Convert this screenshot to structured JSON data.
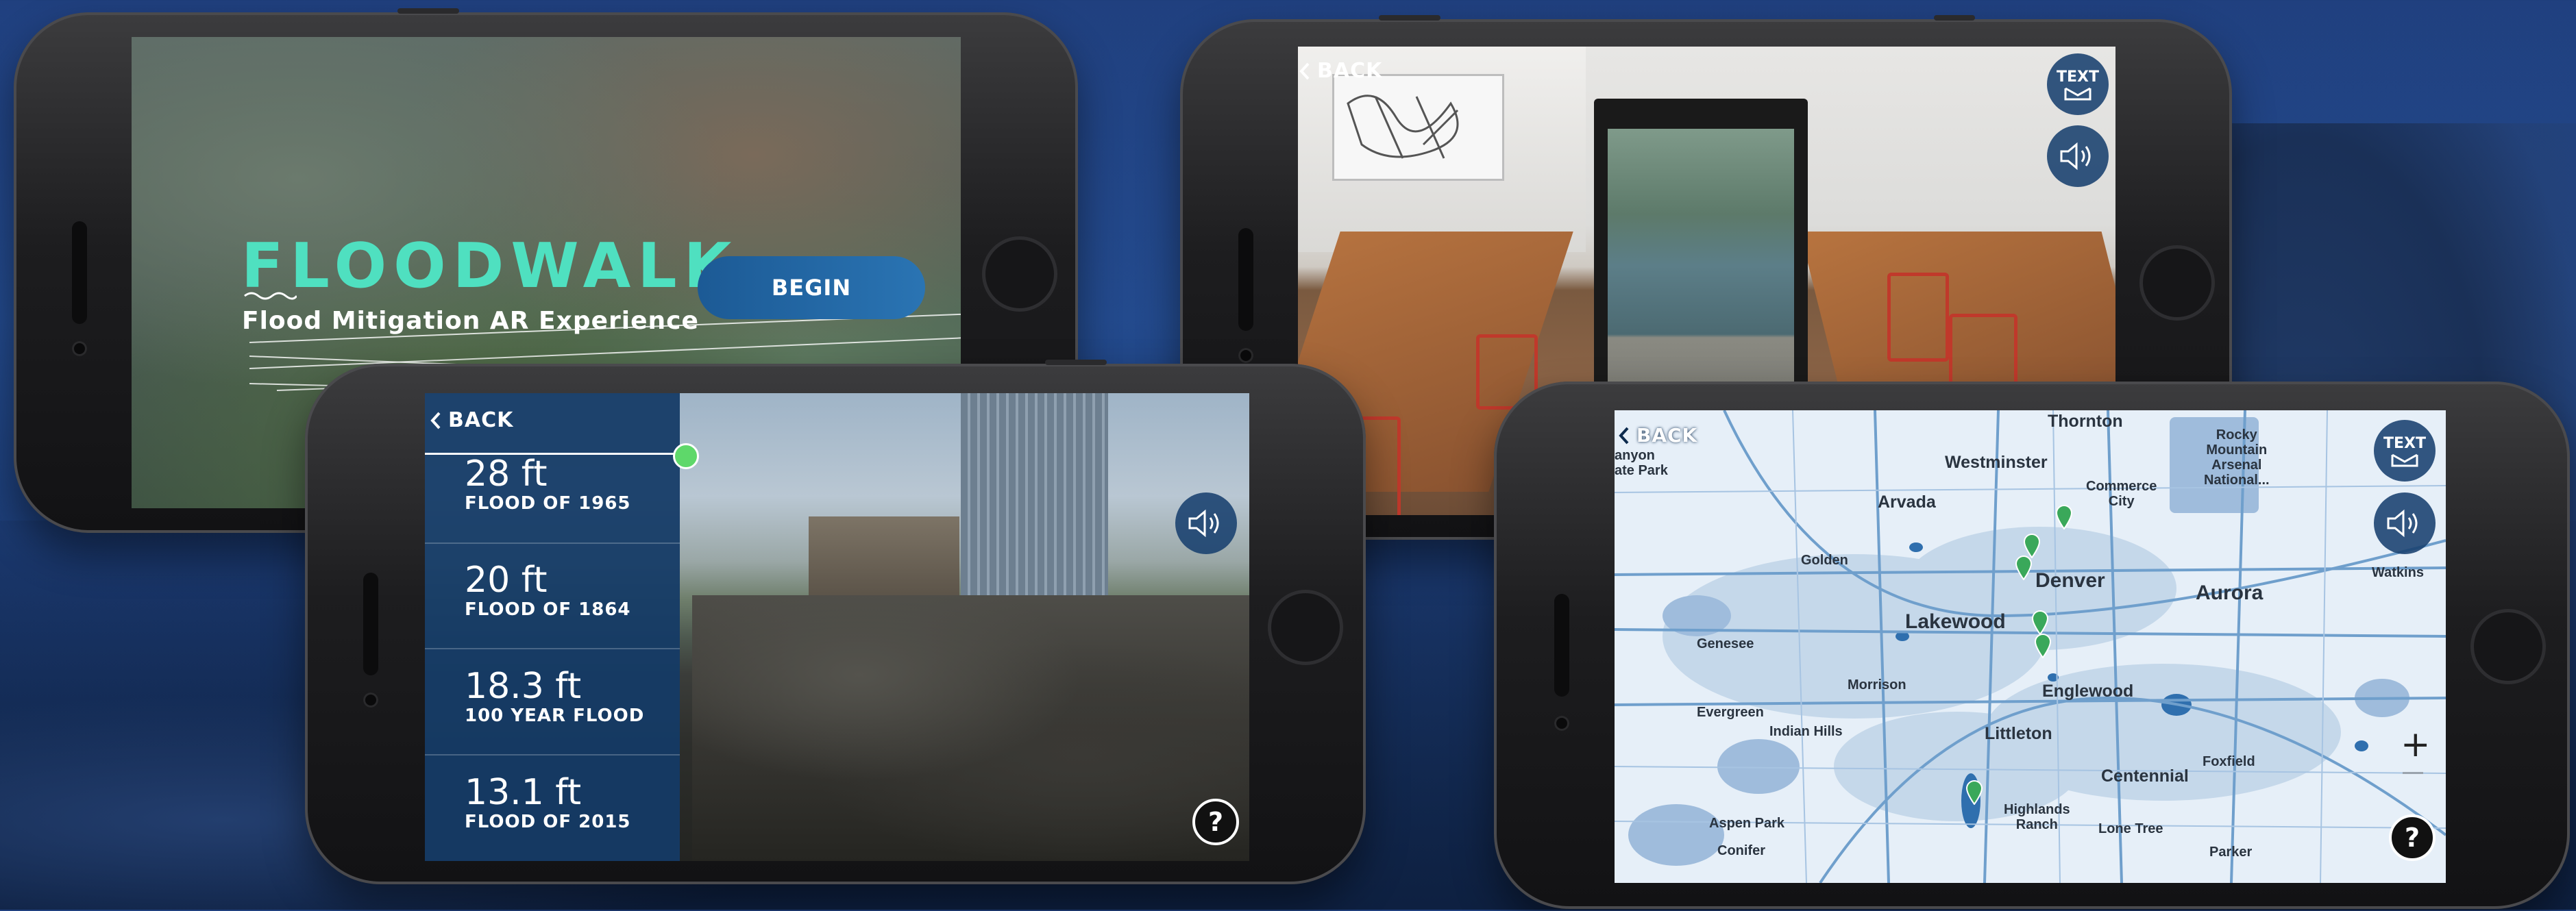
{
  "colors": {
    "title_teal": "#4fe0c0",
    "panel_blue": "#143a66",
    "accent_green": "#5ed86a",
    "button_blue": "#1c5a95"
  },
  "intro": {
    "title": "FLOODWALK",
    "subtitle": "Flood Mitigation AR Experience",
    "begin_label": "BEGIN"
  },
  "flood_screen": {
    "back_label": "BACK",
    "levels": [
      {
        "height": "28 ft",
        "name": "FLOOD OF 1965"
      },
      {
        "height": "20 ft",
        "name": "FLOOD OF 1864"
      },
      {
        "height": "18.3 ft",
        "name": "100 YEAR FLOOD"
      },
      {
        "height": "13.1 ft",
        "name": "FLOOD OF 2015"
      }
    ],
    "slider_level": 1.0,
    "help_label": "?",
    "icons": [
      "chevron-left-icon",
      "speaker-icon",
      "help-icon"
    ]
  },
  "portal_screen": {
    "back_label": "BACK",
    "text_button_label": "TEXT",
    "icons": [
      "chevron-left-icon",
      "text-message-icon",
      "speaker-icon"
    ]
  },
  "map_screen": {
    "back_label": "BACK",
    "text_button_label": "TEXT",
    "help_label": "?",
    "zoom_in_label": "+",
    "cities": {
      "thornton": "Thornton",
      "westminster": "Westminster",
      "rocky_mountain": "Rocky\nMountain\nArsenal\nNational...",
      "commerce_city": "Commerce\nCity",
      "arvada": "Arvada",
      "golden": "Golden",
      "denver": "Denver",
      "aurora": "Aurora",
      "watkins": "Watkins",
      "lakewood": "Lakewood",
      "genesee": "Genesee",
      "morrison": "Morrison",
      "englewood": "Englewood",
      "evergreen": "Evergreen",
      "indian_hills": "Indian Hills",
      "littleton": "Littleton",
      "centennial": "Centennial",
      "foxfield": "Foxfield",
      "highlands_ranch": "Highlands\nRanch",
      "lone_tree": "Lone Tree",
      "aspen_park": "Aspen Park",
      "conifer": "Conifer",
      "parker": "Parker",
      "canyon": "anyon",
      "state_park": "ate Park"
    }
  }
}
